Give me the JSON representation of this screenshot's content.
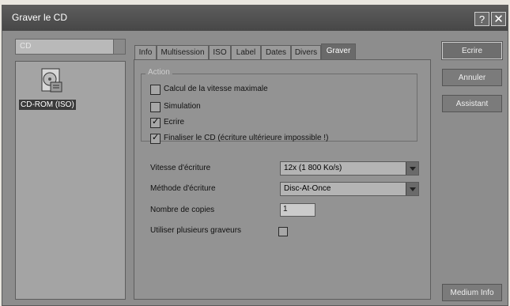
{
  "window": {
    "title": "Graver le CD"
  },
  "left": {
    "dropdown_value": "CD",
    "item_label": "CD-ROM (ISO)"
  },
  "tabs": [
    {
      "label": "Info"
    },
    {
      "label": "Multisession"
    },
    {
      "label": "ISO"
    },
    {
      "label": "Label"
    },
    {
      "label": "Dates"
    },
    {
      "label": "Divers"
    },
    {
      "label": "Graver"
    }
  ],
  "action": {
    "group_label": "Action",
    "calc_speed": {
      "label": "Calcul de la vitesse maximale",
      "checked": false
    },
    "simulation": {
      "label": "Simulation",
      "checked": false
    },
    "ecrire": {
      "label": "Ecrire",
      "checked": true
    },
    "finaliser": {
      "label": "Finaliser le CD (écriture ultérieure impossible !)",
      "checked": true
    }
  },
  "settings": {
    "speed_label": "Vitesse d'écriture",
    "speed_value": "12x (1 800 Ko/s)",
    "method_label": "Méthode d'écriture",
    "method_value": "Disc-At-Once",
    "copies_label": "Nombre de copies",
    "copies_value": "1",
    "multi_label": "Utiliser plusieurs graveurs",
    "multi_checked": false
  },
  "buttons": {
    "ecrire": "Ecrire",
    "annuler": "Annuler",
    "assistant": "Assistant",
    "medium_info": "Medium Info"
  },
  "titlebar_icons": {
    "help": "?",
    "close": "✕"
  }
}
